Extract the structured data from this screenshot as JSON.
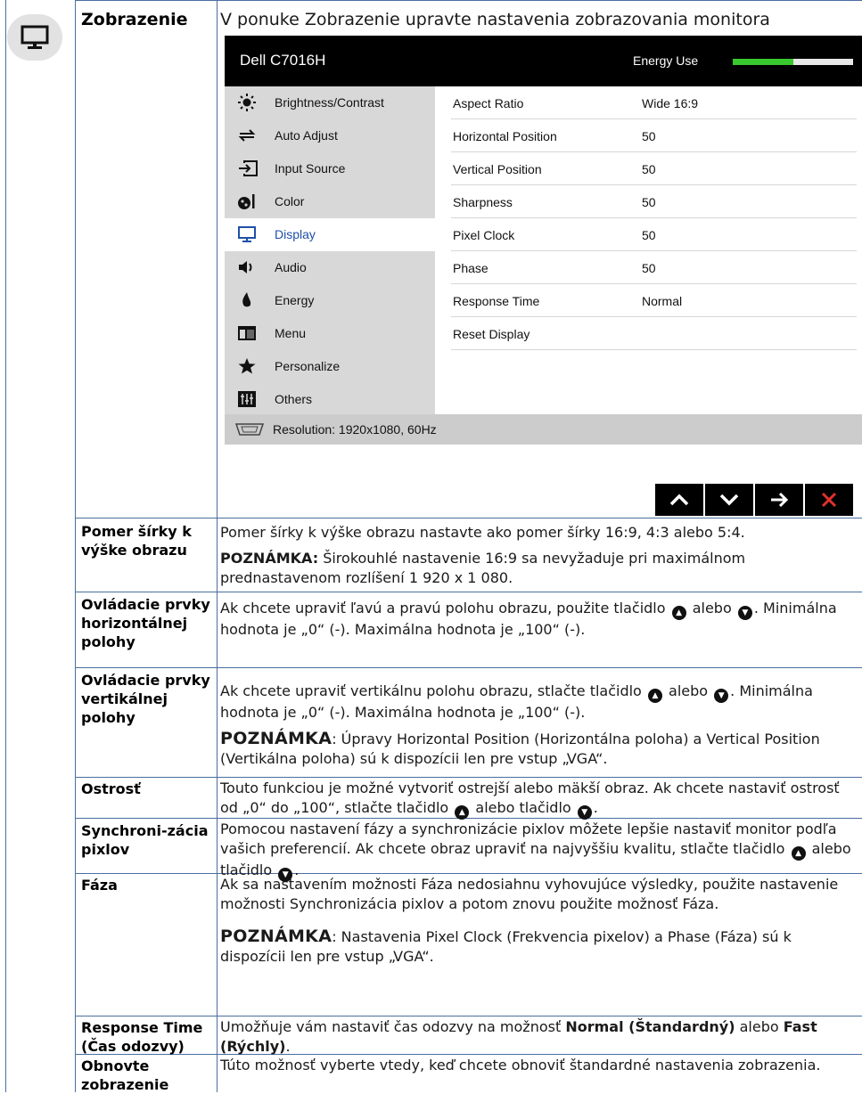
{
  "section": {
    "title": "Zobrazenie",
    "intro": "V ponuke Zobrazenie upravte nastavenia zobrazovania monitora"
  },
  "osd": {
    "model": "Dell C7016H",
    "energy_label": "Energy Use",
    "energy_level": 0.5,
    "colors": {
      "accent": "#38c92e",
      "active_text": "#1f4fa8",
      "close": "#e4312b"
    },
    "menu": [
      {
        "label": "Brightness/Contrast",
        "icon": "sun-icon"
      },
      {
        "label": "Auto Adjust",
        "icon": "auto-adjust-icon"
      },
      {
        "label": "Input Source",
        "icon": "input-source-icon"
      },
      {
        "label": "Color",
        "icon": "color-icon"
      },
      {
        "label": "Display",
        "icon": "monitor-icon",
        "active": true
      },
      {
        "label": "Audio",
        "icon": "speaker-icon"
      },
      {
        "label": "Energy",
        "icon": "flame-icon"
      },
      {
        "label": "Menu",
        "icon": "menu-icon"
      },
      {
        "label": "Personalize",
        "icon": "star-icon"
      },
      {
        "label": "Others",
        "icon": "sliders-icon"
      }
    ],
    "settings": [
      {
        "name": "Aspect Ratio",
        "value": "Wide 16:9"
      },
      {
        "name": "Horizontal Position",
        "value": "50"
      },
      {
        "name": "Vertical Position",
        "value": "50"
      },
      {
        "name": "Sharpness",
        "value": "50"
      },
      {
        "name": "Pixel Clock",
        "value": "50"
      },
      {
        "name": "Phase",
        "value": "50"
      },
      {
        "name": "Response Time",
        "value": "Normal"
      },
      {
        "name": "Reset Display",
        "value": ""
      }
    ],
    "resolution": "Resolution: 1920x1080, 60Hz",
    "nav_icons": [
      "chevron-up-icon",
      "chevron-down-icon",
      "arrow-right-icon",
      "close-icon"
    ]
  },
  "rows": {
    "aspect": {
      "label": "Pomer šírky k výške obrazu",
      "text": "Pomer šírky k výške obrazu nastavte ako pomer šírky 16:9, 4:3 alebo 5:4.",
      "note_head": "POZNÁMKA:",
      "note_text": " Širokouhlé nastavenie 16:9 sa nevyžaduje pri maximálnom prednastavenom rozlíšení 1 920 x 1 080."
    },
    "hpos": {
      "label": "Ovládacie prvky horizontálnej polohy",
      "text_a": "Ak chcete upraviť ľavú a pravú polohu obrazu, použite tlačidlo",
      "text_or": " alebo ",
      "text_b": ". Minimálna hodnota je „0“ (-). Maximálna hodnota je „100“ (-)."
    },
    "vpos": {
      "label": "Ovládacie prvky vertikálnej polohy",
      "text_a": "Ak chcete upraviť vertikálnu polohu obrazu, stlačte tlačidlo",
      "text_or": " alebo ",
      "text_b": ". Minimálna hodnota je „0“ (-). Maximálna hodnota je „100“ (-).",
      "note_head": "POZNÁMKA",
      "note_text": ": Úpravy Horizontal Position (Horizontálna poloha) a Vertical Position (Vertikálna poloha) sú k dispozícii len pre vstup „VGA“."
    },
    "sharp": {
      "label": "Ostrosť",
      "text_a": "Touto funkciou je možné vytvoriť ostrejší alebo mäkší obraz. Ak chcete nastaviť ostrosť od „0“ do „100“, stlačte tlačidlo",
      "text_or": " alebo tlačidlo ",
      "text_b": "."
    },
    "clock": {
      "label": "Synchroni-zácia pixlov",
      "text_a": "Pomocou nastavení fázy a synchronizácie pixlov môžete lepšie nastaviť monitor podľa vašich preferencií. Ak chcete obraz upraviť na najvyššiu kvalitu, stlačte tlačidlo",
      "text_or": " alebo tlačidlo ",
      "text_b": "."
    },
    "phase": {
      "label": "Fáza",
      "text": "Ak sa nastavením možnosti Fáza nedosiahnu vyhovujúce výsledky, použite nastavenie možnosti Synchronizácia pixlov a potom znovu použite možnosť Fáza.",
      "note_head": "POZNÁMKA",
      "note_text": ": Nastavenia Pixel Clock (Frekvencia pixelov) a Phase (Fáza) sú k dispozícii len pre vstup „VGA“."
    },
    "response": {
      "label": "Response Time (Čas odozvy)",
      "text_a": "Umožňuje vám nastaviť čas odozvy na možnosť ",
      "bold_a": "Normal (Štandardný)",
      "text_mid": " alebo ",
      "bold_b": "Fast (Rýchly)",
      "text_end": "."
    },
    "reset": {
      "label": "Obnovte zobrazenie",
      "text": "Túto možnosť vyberte vtedy, keď chcete obnoviť štandardné nastavenia zobrazenia."
    }
  }
}
